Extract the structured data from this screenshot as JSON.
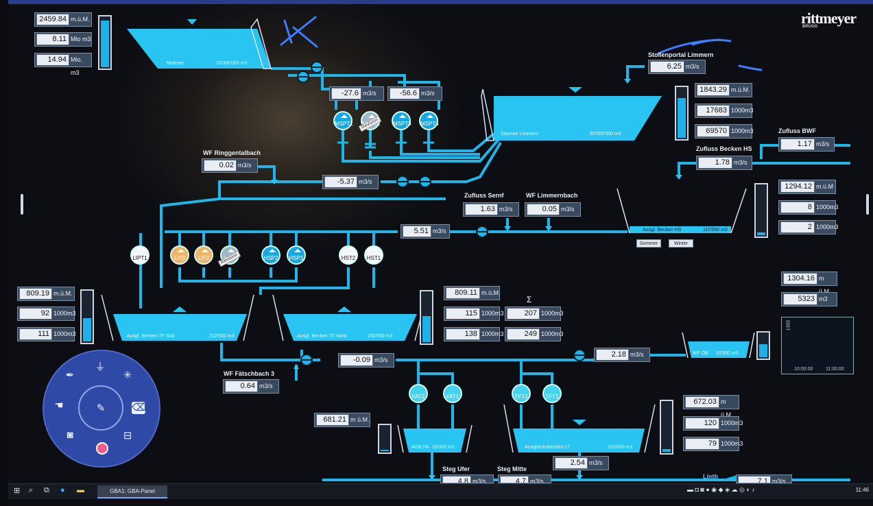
{
  "brand": {
    "name": "rittmeyer",
    "sub": "BRUGG"
  },
  "colors": {
    "water": "#29c4f2",
    "pipe": "#1fb6ea",
    "panel": "#e9eef5",
    "bg": "#0e1118"
  },
  "muttsee": {
    "level": "2459.84",
    "level_unit": "m.ü.M.",
    "vol1": "8.11",
    "vol1_unit": "Mio m3",
    "vol2": "14.94",
    "vol2_unit": "Mio. m3",
    "name": "Muttsee",
    "capacity": "25'000'000 m3",
    "gauge_fill": 0.95
  },
  "stausee": {
    "name": "Stausee Limmern",
    "capacity": "92'000'000 m3",
    "level": "1843.29",
    "level_unit": "m.ü.M.",
    "vol1": "17683",
    "vol1_unit": "1000m3",
    "vol2": "69570",
    "vol2_unit": "1000m3",
    "gauge_fill": 0.82
  },
  "stollenportal": {
    "label": "Stollenportal Limmern",
    "value": "6.25",
    "unit": "m3/s"
  },
  "zufluss_bwf": {
    "label": "Zufluss BWF",
    "value": "1.17",
    "unit": "m3/s"
  },
  "zufluss_hs": {
    "label": "Zufluss Becken HS",
    "value": "1.78",
    "unit": "m3/s"
  },
  "msp_flow1": {
    "value": "-27.6",
    "unit": "m3/s"
  },
  "msp_flow2": {
    "value": "-56.6",
    "unit": "m3/s"
  },
  "msp_pumps": [
    "MSPT1",
    "MSPT2",
    "MSPT3",
    "MSPT4"
  ],
  "revision": "Revision",
  "ringgental": {
    "label": "WF Ringgentalbach",
    "value": "0.02",
    "unit": "m3/s"
  },
  "flow_mid": {
    "value": "-5.37",
    "unit": "m3/s"
  },
  "zufluss_sernf": {
    "label": "Zufluss Sernf",
    "value": "1.63",
    "unit": "m3/s"
  },
  "wf_limmernbach": {
    "label": "WF Limmernbach",
    "value": "0.05",
    "unit": "m3/s"
  },
  "flow_main": {
    "value": "5.51",
    "unit": "m3/s"
  },
  "becken_hs": {
    "name": "Ausgl. Becken HS",
    "capacity": "110'000 m3",
    "level": "1294.12",
    "level_unit": "m.ü.M",
    "vol1": "8",
    "vol1_unit": "1000m3",
    "vol2": "2",
    "vol2_unit": "1000m3",
    "gauge_fill": 0.1,
    "btn_summer": "Sommer",
    "btn_winter": "Winter"
  },
  "mid_pumps": [
    "LIPT1",
    "LIT3",
    "LIT2",
    "LIT1",
    "HSP2",
    "HSP1",
    "HST2",
    "HST1"
  ],
  "tf_sued": {
    "name": "Ausgl. Becken TF Süd",
    "capacity": "210'000 m3",
    "level": "809.19",
    "level_unit": "m.ü.M.",
    "vol1": "92",
    "vol1_unit": "1000m3",
    "vol2": "111",
    "vol2_unit": "1000m3",
    "gauge_fill": 0.5
  },
  "tf_nord": {
    "name": "Ausgl. Becken TF Nord",
    "capacity": "230'000 m3",
    "level": "809.11",
    "level_unit": "m.ü.M.",
    "vol1": "115",
    "vol1_unit": "1000m3",
    "vol2": "138",
    "vol2_unit": "1000m3",
    "gauge_fill": 0.55
  },
  "sum": {
    "symbol": "Σ",
    "v1": "207",
    "v1_unit": "1000m3",
    "v2": "249",
    "v2_unit": "1000m3"
  },
  "wf_ob": {
    "name": "WF OB",
    "capacity": "10'500 m3",
    "level": "1304.16",
    "level_unit": "m ü.M.",
    "vol": "5323",
    "vol_unit": "m3",
    "gauge_fill": 0.6
  },
  "trend": {
    "ylabel": "1305",
    "t1": "10:00:00",
    "t2": "11:00:00"
  },
  "flow_low": {
    "value": "-0.09",
    "unit": "m3/s"
  },
  "flow_ob": {
    "value": "2.18",
    "unit": "m3/s"
  },
  "faetschbach": {
    "label": "WF Fätschbach 3",
    "value": "0.64",
    "unit": "m3/s"
  },
  "low_pumps": [
    "FAT2",
    "FAT1",
    "TFT2",
    "TFT1"
  ],
  "agb_fa": {
    "name": "AGB FA",
    "capacity": "10'000 m3",
    "level": "681.21",
    "level_unit": "m ü.M.",
    "gauge_fill": 0.15
  },
  "lt": {
    "name": "Ausgleichsbecken LT",
    "capacity": "210'000 m3",
    "level": "672.03",
    "level_unit": "m ü.M.",
    "vol1": "120",
    "vol1_unit": "1000m3",
    "vol2": "79",
    "vol2_unit": "1000m3",
    "gauge_fill": 0.1,
    "outflow": "2.54",
    "outflow_unit": "m3/s"
  },
  "steg_ufer": {
    "label": "Steg Ufer",
    "value": "4.8",
    "unit": "m3/s"
  },
  "steg_mitte": {
    "label": "Steg Mitte",
    "value": "4.7",
    "unit": "m3/s"
  },
  "linth": {
    "label": "Linth",
    "value": "7.1",
    "unit": "m3/s"
  },
  "taskbar": {
    "app": "GBA1: GBA-Panel",
    "time": "11:46"
  }
}
